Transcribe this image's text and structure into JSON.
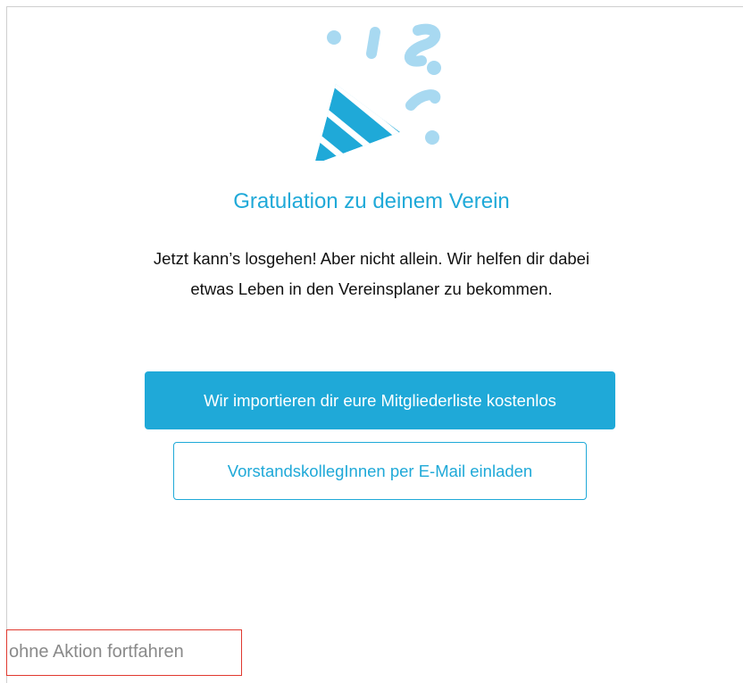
{
  "illustration": {
    "icon": "party-popper-icon",
    "colors": {
      "cone": "#1fa9d8",
      "confetti": "#a8d9f1"
    }
  },
  "dialog": {
    "title": "Gratulation zu deinem Verein",
    "subtitle_line1": "Jetzt kann’s losgehen! Aber nicht allein. Wir helfen dir dabei",
    "subtitle_line2": "etwas Leben in den Vereinsplaner zu bekommen."
  },
  "actions": {
    "import_label": "Wir importieren dir eure Mitgliederliste kostenlos",
    "invite_label": "VorstandskollegInnen per E-Mail einladen",
    "skip_label": "ohne Aktion fortfahren"
  },
  "colors": {
    "accent": "#1fa9d8",
    "skip_text": "#8a8a8a",
    "highlight_border": "#e0392f"
  }
}
